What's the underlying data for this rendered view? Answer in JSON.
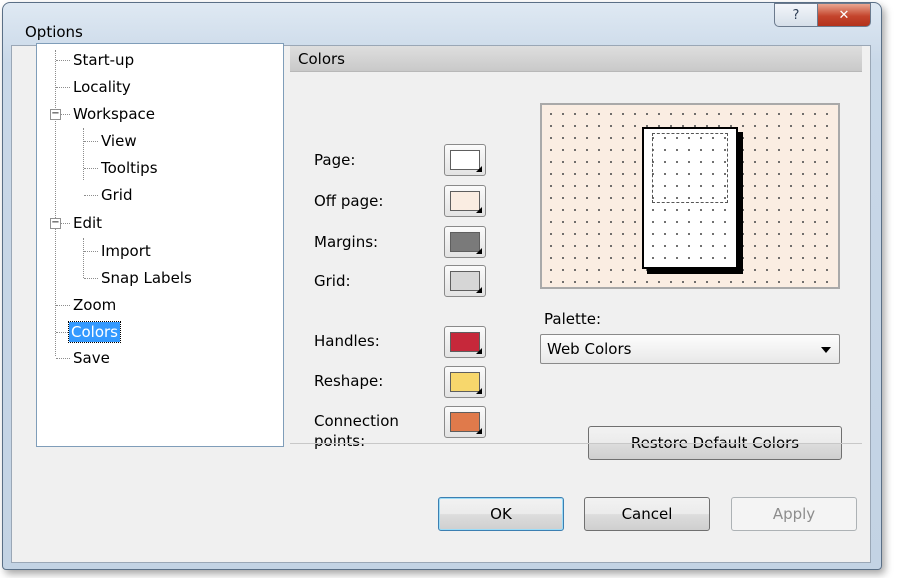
{
  "window": {
    "title": "Options"
  },
  "titlebar": {
    "help_icon": "question-mark-icon",
    "close_icon": "close-x-icon"
  },
  "tree": {
    "items": [
      {
        "label": "Start-up",
        "level": 0
      },
      {
        "label": "Locality",
        "level": 0
      },
      {
        "label": "Workspace",
        "level": 0,
        "expanded": true
      },
      {
        "label": "View",
        "level": 1
      },
      {
        "label": "Tooltips",
        "level": 1
      },
      {
        "label": "Grid",
        "level": 1
      },
      {
        "label": "Edit",
        "level": 0,
        "expanded": true
      },
      {
        "label": "Import",
        "level": 1
      },
      {
        "label": "Snap Labels",
        "level": 1
      },
      {
        "label": "Zoom",
        "level": 0
      },
      {
        "label": "Colors",
        "level": 0,
        "selected": true
      },
      {
        "label": "Save",
        "level": 0
      }
    ]
  },
  "section": {
    "title": "Colors"
  },
  "colors": [
    {
      "label": "Page:",
      "color": "#ffffff"
    },
    {
      "label": "Off page:",
      "color": "#faede2"
    },
    {
      "label": "Margins:",
      "color": "#7a7a7a"
    },
    {
      "label": "Grid:",
      "color": "#d6d6d6"
    },
    {
      "label": "Handles:",
      "color": "#c6283a"
    },
    {
      "label": "Reshape:",
      "color": "#f7d76c"
    },
    {
      "label": "Connection points:",
      "color": "#e07a4b"
    }
  ],
  "palette": {
    "label": "Palette:",
    "value": "Web Colors"
  },
  "buttons": {
    "restore": "Restore Default Colors",
    "ok": "OK",
    "cancel": "Cancel",
    "apply": "Apply"
  }
}
